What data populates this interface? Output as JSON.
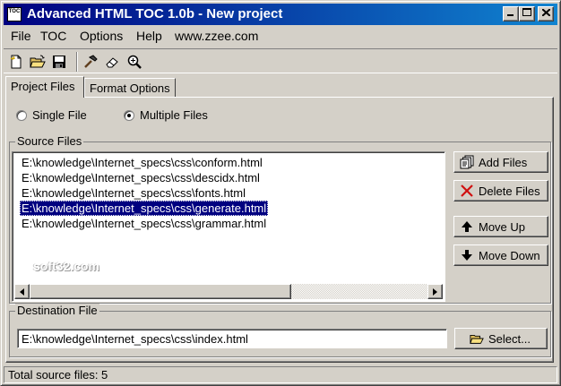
{
  "window": {
    "title": "Advanced HTML TOC 1.0b - New project",
    "icon_text": "TOC"
  },
  "menu": {
    "file": "File",
    "toc": "TOC",
    "options": "Options",
    "help": "Help",
    "website": "www.zzee.com"
  },
  "toolbar": {
    "icons": [
      "new-file-icon",
      "open-folder-icon",
      "save-icon",
      "build-hammer-icon",
      "eraser-icon",
      "zoom-icon"
    ]
  },
  "tabs": [
    {
      "label": "Project Files",
      "active": true
    },
    {
      "label": "Format Options",
      "active": false
    }
  ],
  "mode": {
    "single_label": "Single File",
    "multiple_label": "Multiple Files",
    "selected": "multiple"
  },
  "source": {
    "label": "Source Files",
    "files": [
      "E:\\knowledge\\Internet_specs\\css\\conform.html",
      "E:\\knowledge\\Internet_specs\\css\\descidx.html",
      "E:\\knowledge\\Internet_specs\\css\\fonts.html",
      "E:\\knowledge\\Internet_specs\\css\\generate.html",
      "E:\\knowledge\\Internet_specs\\css\\grammar.html"
    ],
    "selected_index": 3,
    "watermark": "soft32.com"
  },
  "buttons": {
    "add": "Add Files",
    "delete": "Delete Files",
    "up": "Move Up",
    "down": "Move Down",
    "select": "Select..."
  },
  "destination": {
    "label": "Destination File",
    "value": "E:\\knowledge\\Internet_specs\\css\\index.html"
  },
  "status": {
    "text": "Total source files: 5"
  },
  "colors": {
    "title_start": "#000080",
    "title_end": "#1084d0",
    "selection": "#000080",
    "face": "#d4d0c8"
  }
}
